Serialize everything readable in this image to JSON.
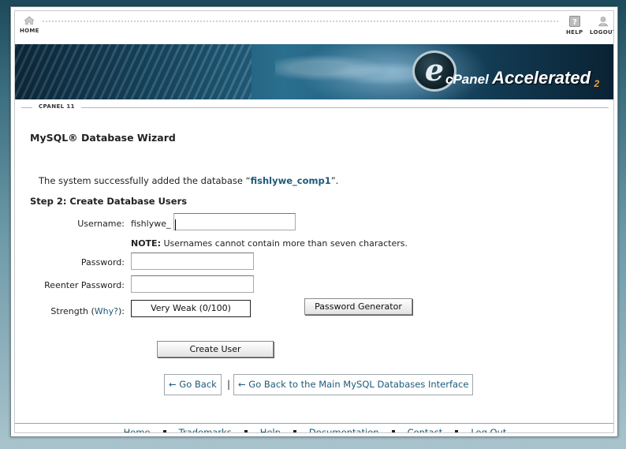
{
  "topnav": {
    "home_label": "HOME",
    "help_label": "HELP",
    "logout_label": "LOGOUT"
  },
  "banner": {
    "logo_cpanel": "cPanel",
    "logo_accelerated": "Accelerated",
    "logo_version": "2"
  },
  "breadcrumb_label": "CPANEL 11",
  "page_title": "MySQL® Database Wizard",
  "success": {
    "prefix": "The system successfully added the database “",
    "database_name": "fishlywe_comp1",
    "suffix": "”."
  },
  "step_title": "Step 2: Create Database Users",
  "form": {
    "username_label": "Username:",
    "username_prefix": "fishlywe_",
    "username_value": "",
    "note_bold": "NOTE:",
    "note_text": " Usernames cannot contain more than seven characters.",
    "password_label": "Password:",
    "password_value": "",
    "reenter_label": "Reenter Password:",
    "reenter_value": "",
    "strength_label_prefix": "Strength (",
    "strength_why": "Why?",
    "strength_label_suffix": "):",
    "strength_value": "Very Weak (0/100)",
    "password_generator_label": "Password Generator",
    "create_user_label": "Create User"
  },
  "navigation": {
    "go_back_label": "← Go Back",
    "separator": "|",
    "go_back_main_label": "← Go Back to the Main MySQL Databases Interface"
  },
  "footer": {
    "links": [
      "Home",
      "Trademarks",
      "Help",
      "Documentation",
      "Contact",
      "Log Out"
    ]
  }
}
